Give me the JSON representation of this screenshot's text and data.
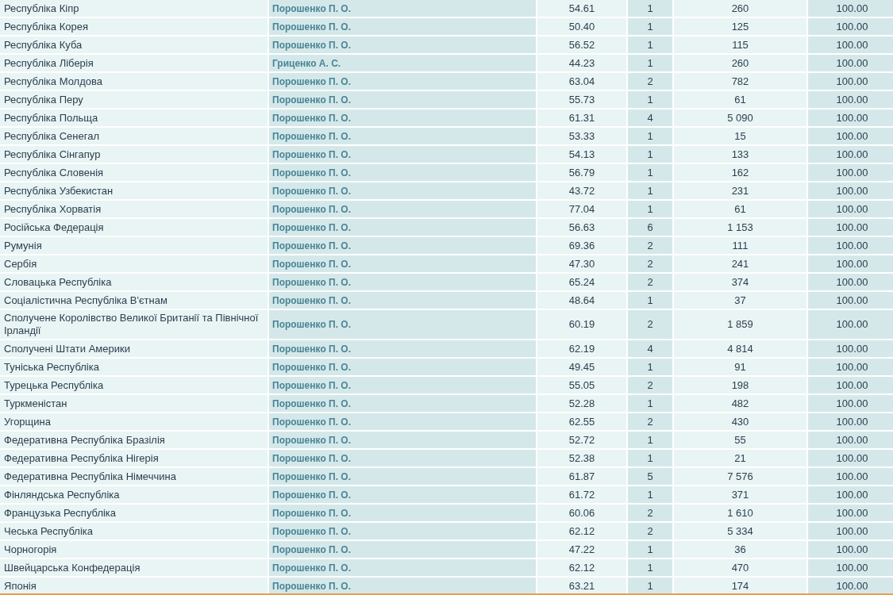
{
  "table": {
    "rows": [
      [
        "Республіка Кіпр",
        "Порошенко П. О.",
        "54.61",
        "1",
        "260",
        "100.00"
      ],
      [
        "Республіка Корея",
        "Порошенко П. О.",
        "50.40",
        "1",
        "125",
        "100.00"
      ],
      [
        "Республіка Куба",
        "Порошенко П. О.",
        "56.52",
        "1",
        "115",
        "100.00"
      ],
      [
        "Республіка Ліберія",
        "Гриценко А. С.",
        "44.23",
        "1",
        "260",
        "100.00"
      ],
      [
        "Республіка Молдова",
        "Порошенко П. О.",
        "63.04",
        "2",
        "782",
        "100.00"
      ],
      [
        "Республіка Перу",
        "Порошенко П. О.",
        "55.73",
        "1",
        "61",
        "100.00"
      ],
      [
        "Республіка Польща",
        "Порошенко П. О.",
        "61.31",
        "4",
        "5 090",
        "100.00"
      ],
      [
        "Республіка Сенегал",
        "Порошенко П. О.",
        "53.33",
        "1",
        "15",
        "100.00"
      ],
      [
        "Республіка Сінгапур",
        "Порошенко П. О.",
        "54.13",
        "1",
        "133",
        "100.00"
      ],
      [
        "Республіка Словенія",
        "Порошенко П. О.",
        "56.79",
        "1",
        "162",
        "100.00"
      ],
      [
        "Республіка Узбекистан",
        "Порошенко П. О.",
        "43.72",
        "1",
        "231",
        "100.00"
      ],
      [
        "Республіка Хорватія",
        "Порошенко П. О.",
        "77.04",
        "1",
        "61",
        "100.00"
      ],
      [
        "Російська Федерація",
        "Порошенко П. О.",
        "56.63",
        "6",
        "1 153",
        "100.00"
      ],
      [
        "Румунія",
        "Порошенко П. О.",
        "69.36",
        "2",
        "111",
        "100.00"
      ],
      [
        "Сербія",
        "Порошенко П. О.",
        "47.30",
        "2",
        "241",
        "100.00"
      ],
      [
        "Словацька Республіка",
        "Порошенко П. О.",
        "65.24",
        "2",
        "374",
        "100.00"
      ],
      [
        "Соціалістична Республіка В'єтнам",
        "Порошенко П. О.",
        "48.64",
        "1",
        "37",
        "100.00"
      ],
      [
        "Сполучене Королівство Великої Британії та Північної Ірландії",
        "Порошенко П. О.",
        "60.19",
        "2",
        "1 859",
        "100.00"
      ],
      [
        "Сполучені Штати Америки",
        "Порошенко П. О.",
        "62.19",
        "4",
        "4 814",
        "100.00"
      ],
      [
        "Туніська Республіка",
        "Порошенко П. О.",
        "49.45",
        "1",
        "91",
        "100.00"
      ],
      [
        "Турецька Республіка",
        "Порошенко П. О.",
        "55.05",
        "2",
        "198",
        "100.00"
      ],
      [
        "Туркменістан",
        "Порошенко П. О.",
        "52.28",
        "1",
        "482",
        "100.00"
      ],
      [
        "Угорщина",
        "Порошенко П. О.",
        "62.55",
        "2",
        "430",
        "100.00"
      ],
      [
        "Федеративна Республіка Бразілія",
        "Порошенко П. О.",
        "52.72",
        "1",
        "55",
        "100.00"
      ],
      [
        "Федеративна Республіка Нігерія",
        "Порошенко П. О.",
        "52.38",
        "1",
        "21",
        "100.00"
      ],
      [
        "Федеративна Республіка Німеччина",
        "Порошенко П. О.",
        "61.87",
        "5",
        "7 576",
        "100.00"
      ],
      [
        "Фінляндська Республіка",
        "Порошенко П. О.",
        "61.72",
        "1",
        "371",
        "100.00"
      ],
      [
        "Французька Республіка",
        "Порошенко П. О.",
        "60.06",
        "2",
        "1 610",
        "100.00"
      ],
      [
        "Чеська Республіка",
        "Порошенко П. О.",
        "62.12",
        "2",
        "5 334",
        "100.00"
      ],
      [
        "Чорногорія",
        "Порошенко П. О.",
        "47.22",
        "1",
        "36",
        "100.00"
      ],
      [
        "Швейцарська Конфедерація",
        "Порошенко П. О.",
        "62.12",
        "1",
        "470",
        "100.00"
      ],
      [
        "Японія",
        "Порошенко П. О.",
        "63.21",
        "1",
        "174",
        "100.00"
      ]
    ]
  }
}
